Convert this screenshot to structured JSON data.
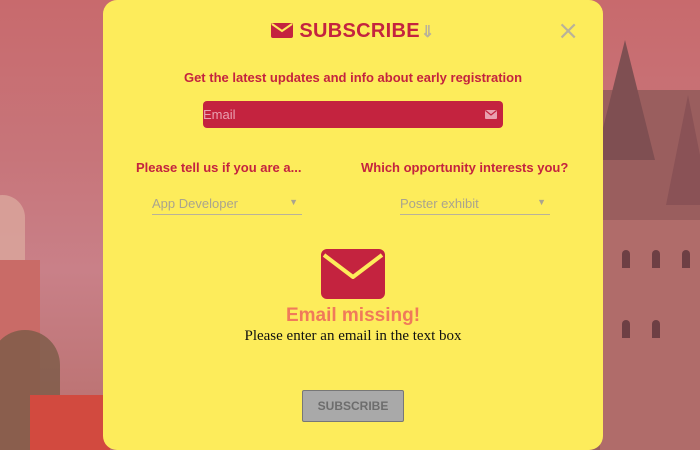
{
  "modal": {
    "title": "SUBSCRIBE",
    "title_suffix_icon": "down-arrow-icon",
    "close_label": "×",
    "subtitle": "Get the latest updates and info about early registration",
    "email": {
      "placeholder": "Email",
      "value": "",
      "icon": "envelope-icon"
    },
    "question_left": "Please tell us if you are a...",
    "question_right": "Which opportunity interests you?",
    "select_left": {
      "selected": "App Developer",
      "arrow": "▼"
    },
    "select_right": {
      "selected": "Poster exhibit",
      "arrow": "▼"
    },
    "error": {
      "icon": "envelope-icon",
      "title": "Email missing!",
      "message": "Please enter an email in the text box"
    },
    "subscribe_button": "SUBSCRIBE"
  },
  "colors": {
    "modal_bg": "#fdec5b",
    "accent": "#c4233f",
    "error_title": "#f07a5a",
    "button_bg": "#a9a9a9"
  }
}
